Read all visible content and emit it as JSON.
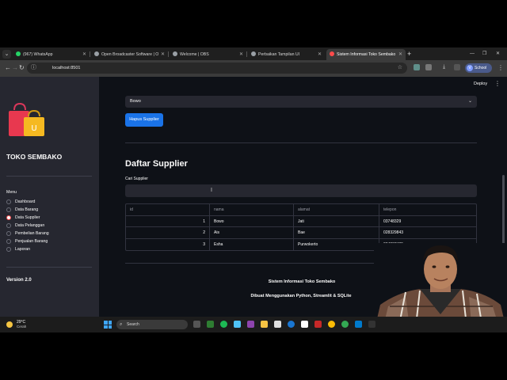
{
  "browser": {
    "tabs": [
      {
        "label": "(967) WhatsApp",
        "active": false,
        "color": "#25d366"
      },
      {
        "label": "Open Broadcaster Software | O",
        "active": false,
        "color": "#9aa0a6"
      },
      {
        "label": "Welcome | OBS",
        "active": false,
        "color": "#9aa0a6"
      },
      {
        "label": "Perbaikan Tampilan UI",
        "active": false,
        "color": "#9aa0a6"
      },
      {
        "label": "Sistem Informasi Toko Sembako",
        "active": true,
        "color": "#ff4b4b"
      }
    ],
    "url": "localhost:8501",
    "profile_label": "School",
    "profile_initial": "V"
  },
  "sidebar": {
    "app_title": "TOKO SEMBAKO",
    "menu_label": "Menu",
    "items": [
      {
        "label": "Dashboard",
        "selected": false
      },
      {
        "label": "Data Barang",
        "selected": false
      },
      {
        "label": "Data Supplier",
        "selected": true
      },
      {
        "label": "Data Pelanggan",
        "selected": false
      },
      {
        "label": "Pembelian Barang",
        "selected": false
      },
      {
        "label": "Penjualan Barang",
        "selected": false
      },
      {
        "label": "Laporan",
        "selected": false
      }
    ],
    "version": "Version 2.0"
  },
  "main": {
    "deploy_label": "Deploy",
    "select_value": "Bowo",
    "delete_button": "Hapus Supplier",
    "section_title": "Daftar Supplier",
    "search_label": "Cari Supplier",
    "search_value": "",
    "table": {
      "columns": [
        "id",
        "nama",
        "alamat",
        "telepon"
      ],
      "rows": [
        [
          "1",
          "Bowo",
          "Jati",
          "03748329"
        ],
        [
          "2",
          "Ais",
          "Bae",
          "028329843"
        ],
        [
          "3",
          "Esha",
          "Purwokerto",
          "034937495"
        ]
      ]
    },
    "footer_title": "Sistem Informasi Toko Sembako",
    "footer_subtitle": "Dibuat Menggunakan Python, Streamlit & SQLite"
  },
  "taskbar": {
    "temperature": "29°C",
    "condition": "Cerah",
    "search_label": "Search"
  },
  "colors": {
    "accent": "#ff4b4b",
    "primary_button": "#1a73e8",
    "sidebar_bg": "#262730",
    "main_bg": "#0e1117"
  }
}
